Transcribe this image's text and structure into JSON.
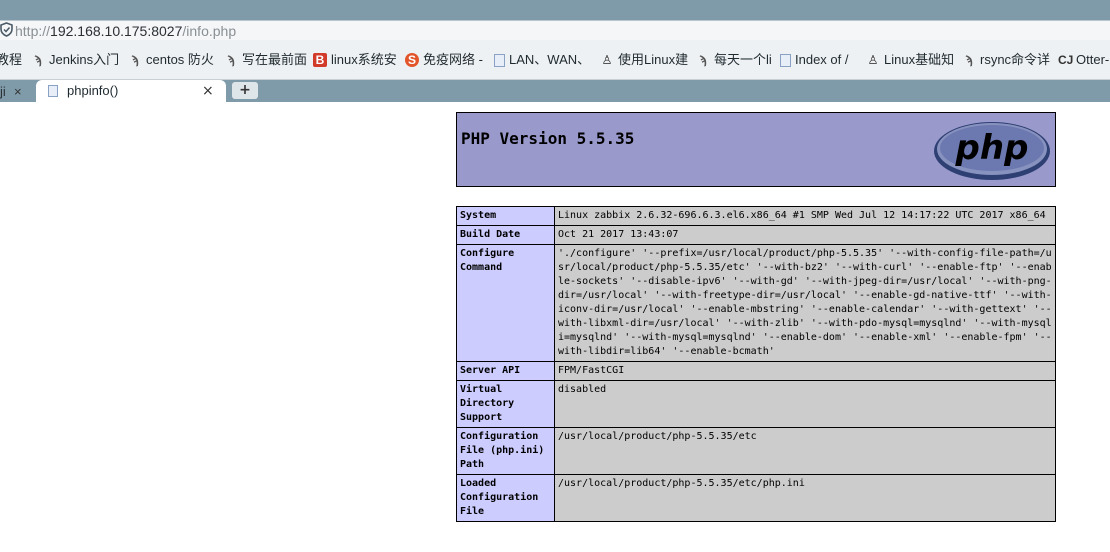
{
  "browser": {
    "url_prefix": "http://",
    "url_host": "192.168.10.175:8027",
    "url_path": "/info.php"
  },
  "bookmarks": [
    {
      "label": "教程",
      "icon": "none"
    },
    {
      "label": "Jenkins入门",
      "icon": "squiggle-icon"
    },
    {
      "label": "centos 防火",
      "icon": "squiggle-icon"
    },
    {
      "label": "写在最前面",
      "icon": "squiggle-icon"
    },
    {
      "label": "linux系统安",
      "icon": "red-b-icon"
    },
    {
      "label": "免疫网络 -",
      "icon": "orange-s-icon"
    },
    {
      "label": "LAN、WAN、",
      "icon": "document-icon"
    },
    {
      "label": "使用Linux建",
      "icon": "penguin-icon"
    },
    {
      "label": "每天一个li",
      "icon": "squiggle-icon"
    },
    {
      "label": "Index of /",
      "icon": "document-icon"
    },
    {
      "label": "Linux基础知",
      "icon": "penguin-icon"
    },
    {
      "label": "rsync命令详",
      "icon": "squiggle-icon"
    },
    {
      "label": "Otter-",
      "icon": "cj-icon"
    }
  ],
  "tabs": {
    "left_partial_label": "ji",
    "active_title": "phpinfo()",
    "close_glyph": "×",
    "new_tab_glyph": "+"
  },
  "phpinfo": {
    "version_title": "PHP Version 5.5.35",
    "logo_text": "php",
    "header_color": "#9999cc",
    "key_color": "#ccccff",
    "value_color": "#cccccc",
    "rows": [
      {
        "key": "System",
        "value": "Linux zabbix 2.6.32-696.6.3.el6.x86_64 #1 SMP Wed Jul 12 14:17:22 UTC 2017 x86_64"
      },
      {
        "key": "Build Date",
        "value": "Oct 21 2017 13:43:07"
      },
      {
        "key": "Configure Command",
        "value": "'./configure' '--prefix=/usr/local/product/php-5.5.35' '--with-config-file-path=/usr/local/product/php-5.5.35/etc' '--with-bz2' '--with-curl' '--enable-ftp' '--enable-sockets' '--disable-ipv6' '--with-gd' '--with-jpeg-dir=/usr/local' '--with-png-dir=/usr/local' '--with-freetype-dir=/usr/local' '--enable-gd-native-ttf' '--with-iconv-dir=/usr/local' '--enable-mbstring' '--enable-calendar' '--with-gettext' '--with-libxml-dir=/usr/local' '--with-zlib' '--with-pdo-mysql=mysqlnd' '--with-mysqli=mysqlnd' '--with-mysql=mysqlnd' '--enable-dom' '--enable-xml' '--enable-fpm' '--with-libdir=lib64' '--enable-bcmath'"
      },
      {
        "key": "Server API",
        "value": "FPM/FastCGI"
      },
      {
        "key": "Virtual Directory Support",
        "value": "disabled"
      },
      {
        "key": "Configuration File (php.ini) Path",
        "value": "/usr/local/product/php-5.5.35/etc"
      },
      {
        "key": "Loaded Configuration File",
        "value": "/usr/local/product/php-5.5.35/etc/php.ini"
      }
    ]
  }
}
